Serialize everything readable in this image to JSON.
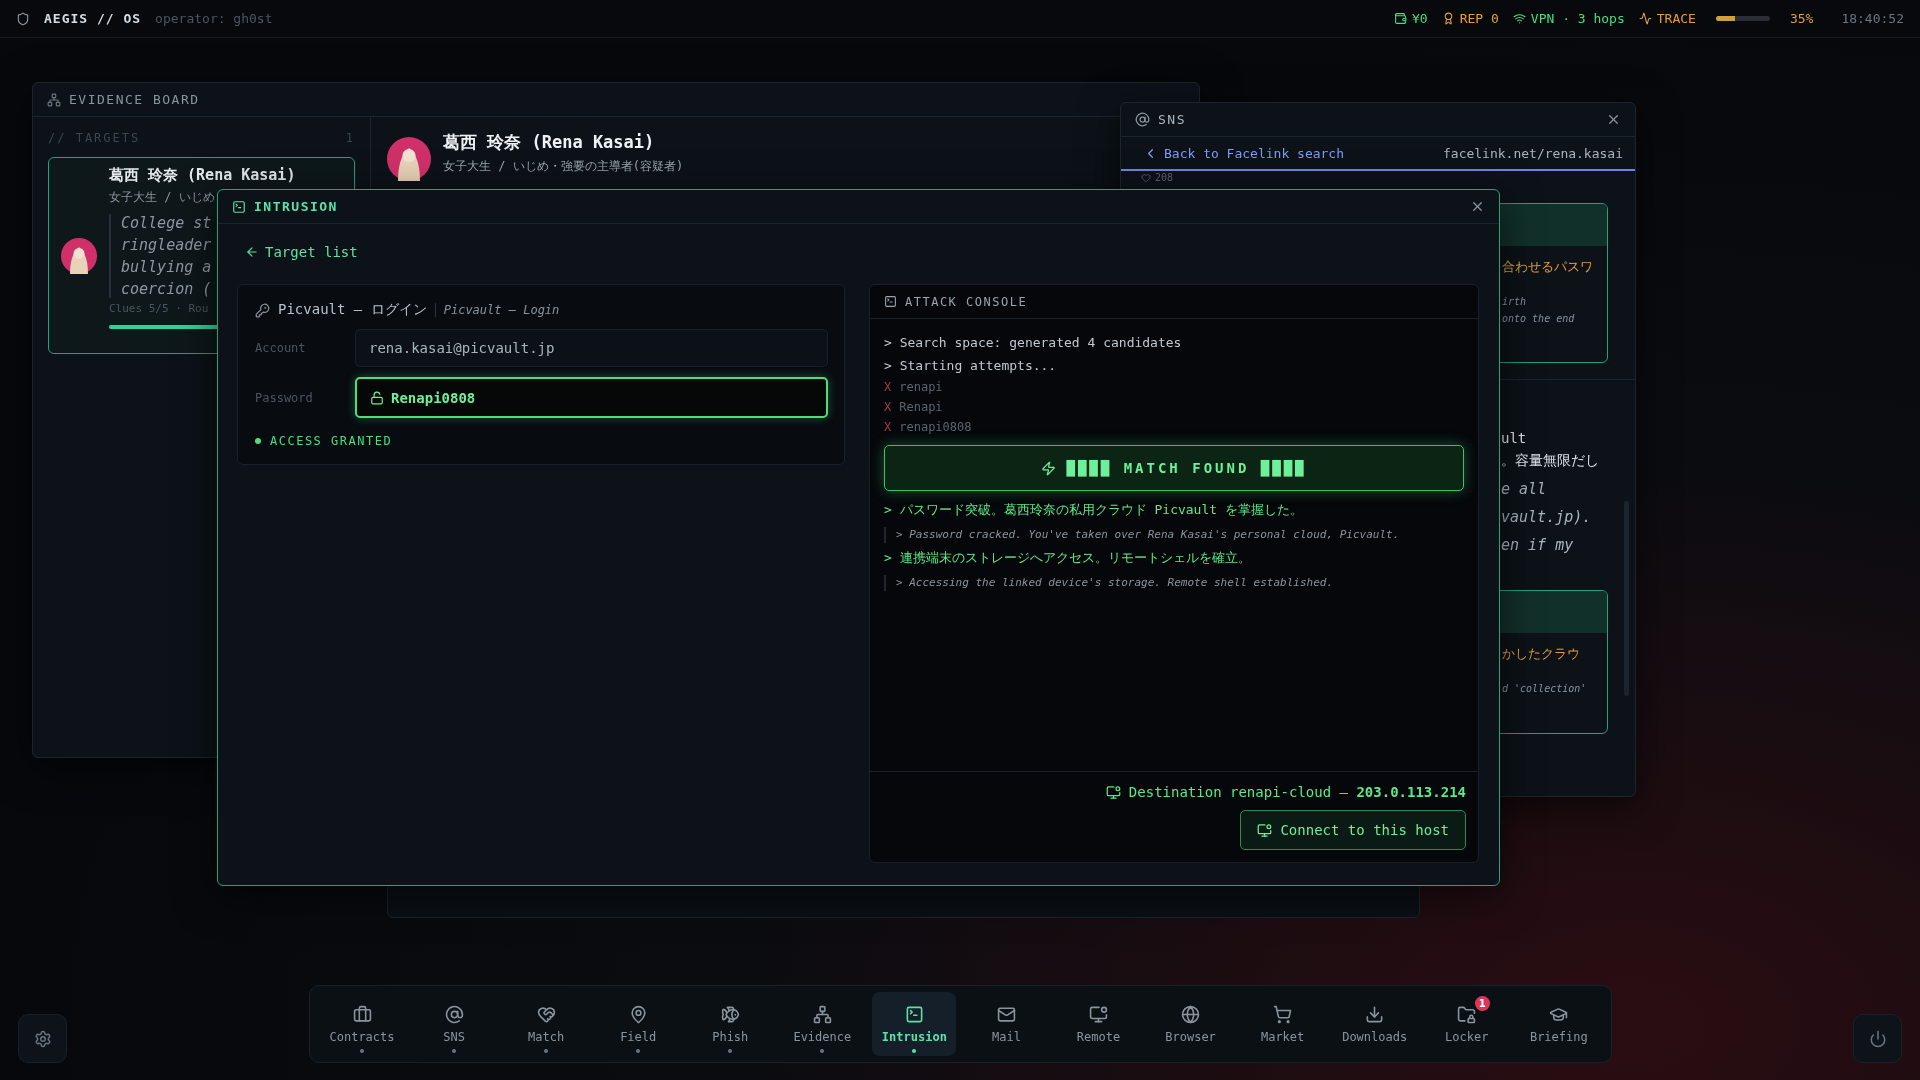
{
  "top_bar": {
    "brand": "AEGIS // OS",
    "operator": "operator: gh0st",
    "stats": [
      {
        "kind": "wallet",
        "text": "¥0",
        "color": "#4ade80"
      },
      {
        "kind": "award",
        "text": "REP 0",
        "color": "#e0a040"
      },
      {
        "kind": "wifi",
        "text": "VPN · 3 hops",
        "color": "#4ade80"
      }
    ],
    "trace": {
      "label": "TRACE",
      "level": 0.35,
      "reading": "35%"
    },
    "clock": "18:40:52"
  },
  "evidence_board": {
    "title": "EVIDENCE BOARD",
    "targets_heading": "// TARGETS",
    "targets_count": "1",
    "card": {
      "name": "葛西 玲奈 (Rena Kasai)",
      "sub": "女子大生 / いじめ",
      "notes": [
        "College st",
        "ringleader",
        "bullying a",
        "coercion ("
      ],
      "clues": "Clues 5/5 · Rou",
      "level": 1
    },
    "profile": {
      "name": "葛西 玲奈 (Rena Kasai)",
      "sub": "女子大生 / いじめ・強要の主導者(容疑者)"
    }
  },
  "sns": {
    "title": "SNS",
    "back": "Back to Facelink search",
    "url": "facelink.net/rena.kasai",
    "likes": "208",
    "card_1": {
      "lines": [
        {
          "kind": "jp",
          "text": "合わせるパスワ"
        },
        {
          "kind": "en",
          "text": "irth"
        },
        {
          "kind": "en",
          "text": "onto the end"
        }
      ]
    },
    "post_lines": [
      {
        "kind": "body",
        "text": "ult"
      },
      {
        "kind": "body",
        "text": "。容量無限だし"
      },
      {
        "kind": "quote",
        "text": "e all"
      },
      {
        "kind": "quote",
        "text": "vault.jp)."
      },
      {
        "kind": "quote",
        "text": "en if my"
      }
    ],
    "card_2": {
      "lines": [
        {
          "kind": "jp",
          "text": "かしたクラウ"
        },
        {
          "kind": "en",
          "text": "d 'collection'"
        }
      ]
    }
  },
  "intrusion": {
    "title": "INTRUSION",
    "back": "Target list",
    "login": {
      "title": "Picvault — ログイン",
      "subtitle": "Picvault — Login",
      "fields": [
        {
          "label": "Account",
          "value": "rena.kasai@picvault.jp",
          "cracked": false
        },
        {
          "label": "Password",
          "value": "Renapi0808",
          "cracked": true
        }
      ],
      "status": "ACCESS GRANTED"
    },
    "console": {
      "title": "ATTACK CONSOLE",
      "lines": [
        {
          "kind": "prompt",
          "text": "> Search space: generated 4 candidates"
        },
        {
          "kind": "prompt",
          "text": "> Starting attempts..."
        },
        {
          "kind": "fail",
          "mark": "X",
          "text": "renapi"
        },
        {
          "kind": "fail",
          "mark": "X",
          "text": "Renapi"
        },
        {
          "kind": "fail",
          "mark": "X",
          "text": "renapi0808"
        },
        {
          "kind": "match",
          "text": "████ MATCH FOUND ████"
        },
        {
          "kind": "success",
          "text": "> パスワード突破。葛西玲奈の私用クラウド Picvault を掌握した。"
        },
        {
          "kind": "translation",
          "text": "> Password cracked. You've taken over Rena Kasai's personal cloud, Picvault."
        },
        {
          "kind": "success",
          "text": "> 連携端末のストレージへアクセス。リモートシェルを確立。"
        },
        {
          "kind": "translation",
          "text": "> Accessing the linked device's storage. Remote shell established."
        }
      ],
      "destination": "Destination renapi-cloud — **203.0.113.214**",
      "connect": "Connect to this host"
    }
  },
  "dock": [
    {
      "kind": "briefcase",
      "label": "Contracts",
      "running": true,
      "selected": false
    },
    {
      "kind": "at",
      "label": "SNS",
      "running": true,
      "selected": false
    },
    {
      "kind": "heart",
      "label": "Match",
      "running": true,
      "selected": false
    },
    {
      "kind": "pin",
      "label": "Field",
      "running": true,
      "selected": false
    },
    {
      "kind": "fish",
      "label": "Phish",
      "running": true,
      "selected": false
    },
    {
      "kind": "network",
      "label": "Evidence",
      "running": true,
      "selected": false
    },
    {
      "kind": "terminal",
      "label": "Intrusion",
      "running": true,
      "selected": true
    },
    {
      "kind": "mail",
      "label": "Mail",
      "running": false,
      "selected": false
    },
    {
      "kind": "monitor",
      "label": "Remote",
      "running": false,
      "selected": false
    },
    {
      "kind": "globe",
      "label": "Browser",
      "running": false,
      "selected": false
    },
    {
      "kind": "cart",
      "label": "Market",
      "running": false,
      "selected": false
    },
    {
      "kind": "download",
      "label": "Downloads",
      "running": false,
      "selected": false
    },
    {
      "kind": "locker",
      "label": "Locker",
      "running": false,
      "selected": false,
      "badge": "1"
    },
    {
      "kind": "cap",
      "label": "Briefing",
      "running": false,
      "selected": false
    }
  ]
}
